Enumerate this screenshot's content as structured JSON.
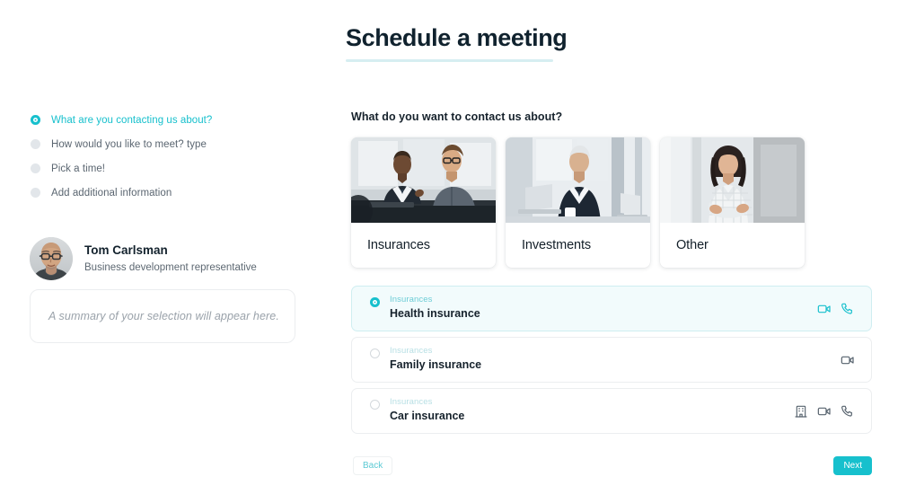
{
  "header": {
    "title": "Schedule a meeting"
  },
  "sidebar": {
    "steps": [
      {
        "label": "What are you contacting us about?",
        "active": true
      },
      {
        "label": "How would you like to meet? type",
        "active": false
      },
      {
        "label": "Pick a time!",
        "active": false
      },
      {
        "label": "Add additional information",
        "active": false
      }
    ],
    "profile": {
      "name": "Tom Carlsman",
      "role": "Business development representative",
      "avatar_icon": "avatar-photo"
    },
    "summary": {
      "placeholder": "A summary of your selection will appear here."
    }
  },
  "main": {
    "question": "What do you want to contact us about?",
    "cards": [
      {
        "label": "Insurances",
        "image_icon": "photo-two-men-meeting"
      },
      {
        "label": "Investments",
        "image_icon": "photo-man-laptop"
      },
      {
        "label": "Other",
        "image_icon": "photo-woman-arms-crossed"
      }
    ],
    "scroll_next_icon": "arrow-right-icon",
    "options": [
      {
        "category": "Insurances",
        "title": "Health insurance",
        "selected": true,
        "icons": [
          "video-icon",
          "phone-icon"
        ]
      },
      {
        "category": "Insurances",
        "title": "Family insurance",
        "selected": false,
        "icons": [
          "video-icon"
        ]
      },
      {
        "category": "Insurances",
        "title": "Car insurance",
        "selected": false,
        "icons": [
          "office-icon",
          "video-icon",
          "phone-icon"
        ]
      }
    ],
    "footer": {
      "back_label": "Back",
      "next_label": "Next"
    }
  },
  "colors": {
    "accent": "#17c0cd",
    "accent_soft": "#f2fbfc",
    "accent_border": "#cfeef1",
    "underline": "#d6eef1",
    "text_dark": "#16222c",
    "text_muted": "#5a6570",
    "icon_dark": "#56626d"
  }
}
